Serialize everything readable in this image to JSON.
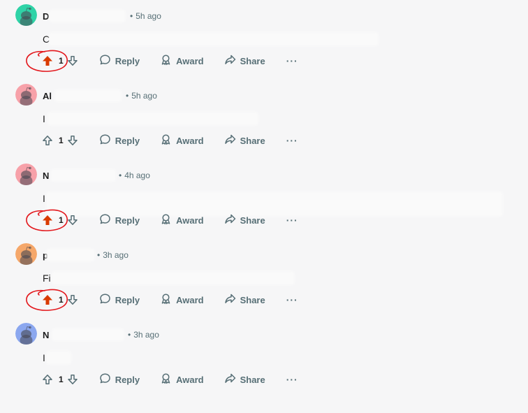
{
  "actions": {
    "reply_label": "Reply",
    "award_label": "Award",
    "share_label": "Share",
    "more_label": "···"
  },
  "colors": {
    "upvote_active": "#d93a00",
    "muted": "#576f76",
    "annotation": "#e3171c"
  },
  "comments": [
    {
      "author": "D",
      "time": "5h ago",
      "body": "C",
      "votes": "1",
      "upvoted": true,
      "avatar_color": "#2fd3a7",
      "annotated": true
    },
    {
      "author": "Al",
      "time": "5h ago",
      "body": "I",
      "votes": "1",
      "upvoted": false,
      "avatar_color": "#f7a1a9",
      "annotated": false
    },
    {
      "author": "N",
      "time": "4h ago",
      "body": "I",
      "votes": "1",
      "upvoted": true,
      "avatar_color": "#f7a1a9",
      "annotated": true
    },
    {
      "author": "p",
      "time": "3h ago",
      "body": "Fi",
      "votes": "1",
      "upvoted": true,
      "avatar_color": "#f5a76a",
      "annotated": true
    },
    {
      "author": "N",
      "time": "3h ago",
      "body": "I",
      "votes": "1",
      "upvoted": false,
      "avatar_color": "#8ba7ef",
      "annotated": false
    }
  ]
}
